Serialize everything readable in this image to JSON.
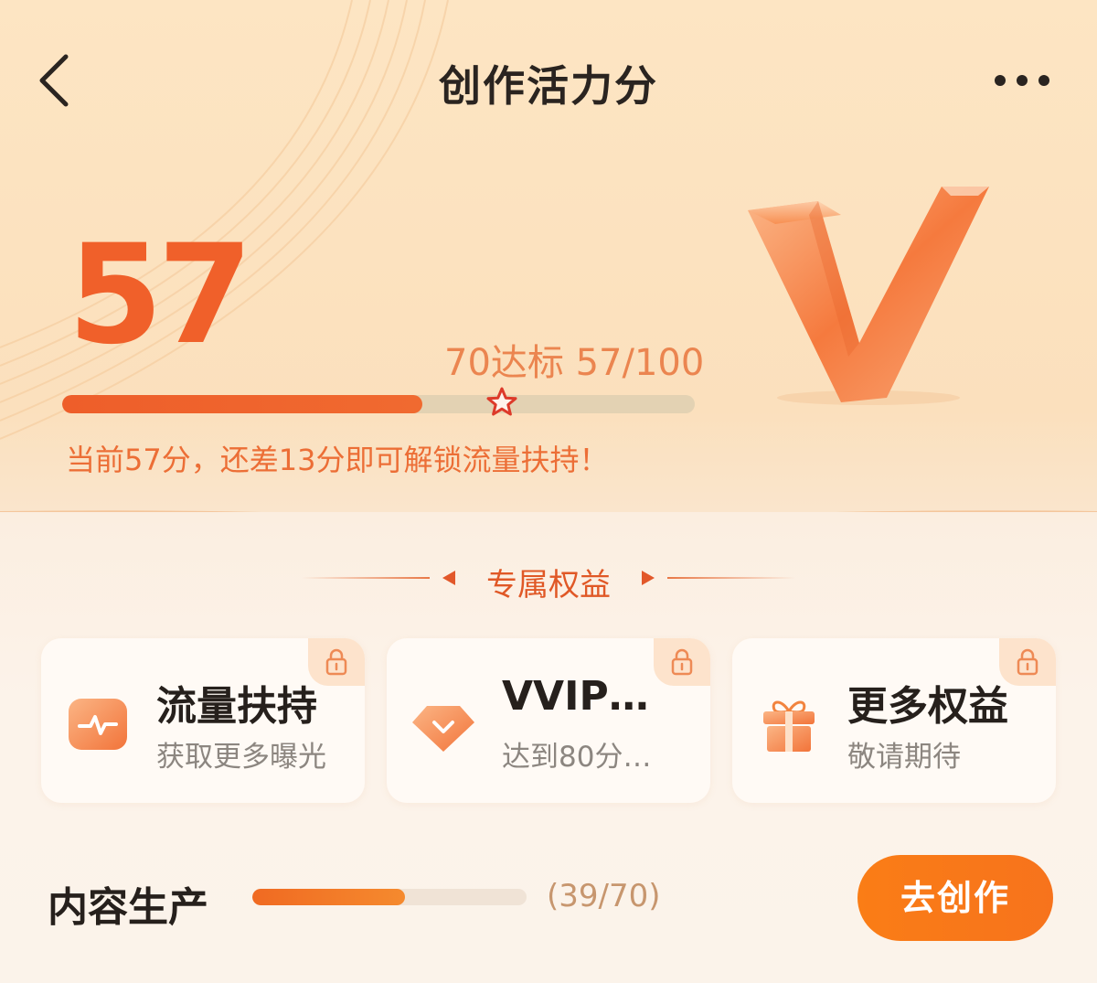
{
  "header": {
    "title": "创作活力分"
  },
  "score": {
    "value": "57",
    "target_text": "70达标 57/100",
    "progress": 0.57,
    "hint": "当前57分，还差13分即可解锁流量扶持！"
  },
  "section": {
    "title": "专属权益"
  },
  "benefits": [
    {
      "title": "流量扶持",
      "subtitle": "获取更多曝光",
      "icon": "pulse-icon"
    },
    {
      "title": "VVIP…",
      "subtitle": "达到80分…",
      "icon": "diamond-icon"
    },
    {
      "title": "更多权益",
      "subtitle": "敬请期待",
      "icon": "gift-icon"
    }
  ],
  "task": {
    "label": "内容生产",
    "count": "(39/70)",
    "progress": 0.557,
    "button_label": "去创作"
  },
  "colors": {
    "accent": "#f0602a",
    "button": "#fa7d16"
  }
}
